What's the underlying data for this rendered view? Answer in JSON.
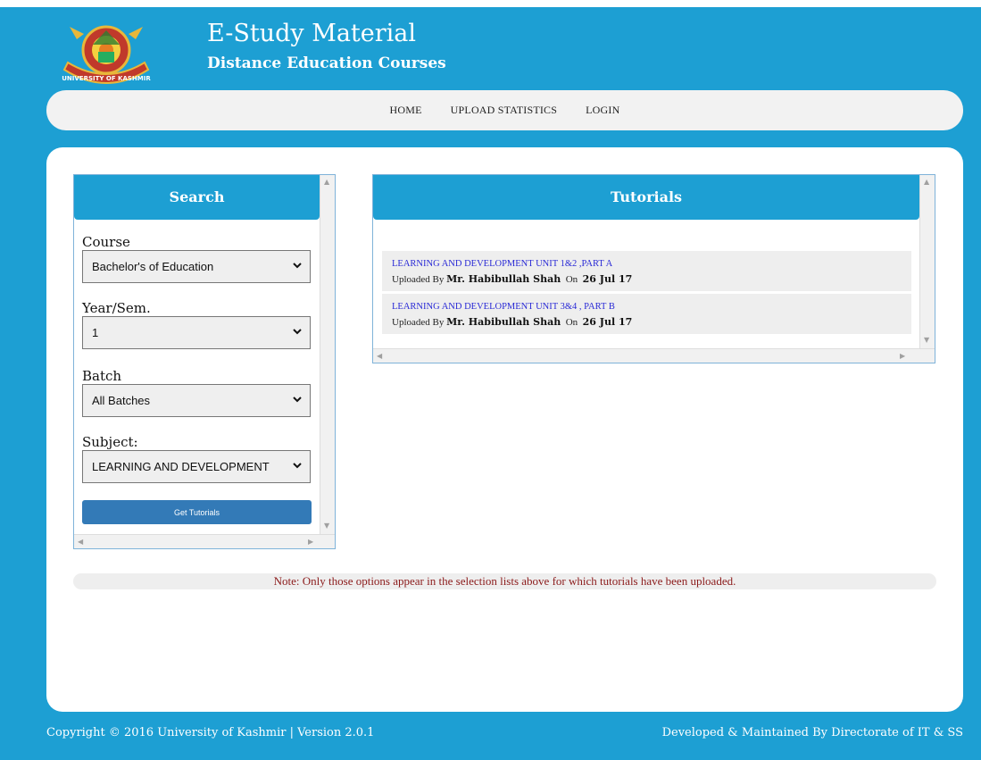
{
  "header": {
    "title": "E-Study Material",
    "subtitle": "Distance Education Courses",
    "logo_text": "UNIVERSITY OF KASHMIR"
  },
  "nav": {
    "items": [
      "HOME",
      "UPLOAD STATISTICS",
      "LOGIN"
    ]
  },
  "search": {
    "heading": "Search",
    "course_label": "Course",
    "course_value": "Bachelor's of Education",
    "year_label": "Year/Sem.",
    "year_value": "1",
    "batch_label": "Batch",
    "batch_value": "All Batches",
    "subject_label": "Subject:",
    "subject_value": "LEARNING AND DEVELOPMENT",
    "button_label": "Get Tutorials"
  },
  "tutorials": {
    "heading": "Tutorials",
    "uploaded_by_label": "Uploaded By",
    "on_label": "On",
    "items": [
      {
        "title": "LEARNING AND DEVELOPMENT UNIT 1&2 ,PART A",
        "uploader": "Mr. Habibullah Shah",
        "date": "26 Jul 17"
      },
      {
        "title": "LEARNING AND DEVELOPMENT UNIT 3&4 , PART B",
        "uploader": "Mr. Habibullah Shah",
        "date": "26 Jul 17"
      }
    ]
  },
  "note": "Note: Only those options appear in the selection lists above for which tutorials have been uploaded.",
  "footer": {
    "copyright": "Copyright © 2016 University of Kashmir | Version 2.0.1",
    "developer": "Developed & Maintained By Directorate of IT & SS"
  },
  "colors": {
    "brand": "#1d9fd3",
    "button": "#337ab7",
    "note_text": "#8b1a1a",
    "link": "#2a2ad6"
  }
}
